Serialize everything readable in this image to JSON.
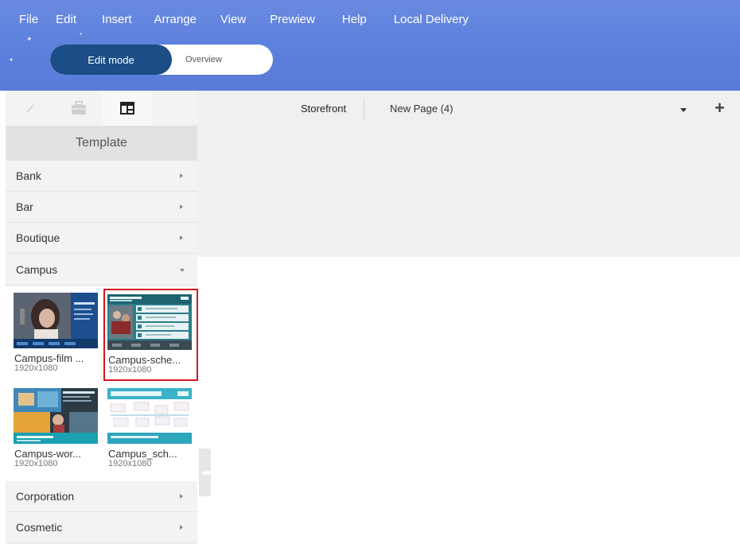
{
  "menu": {
    "items": [
      "File",
      "Edit",
      "Insert",
      "Arrange",
      "View",
      "Prewiew",
      "Help",
      "Local Delivery"
    ]
  },
  "mode_toggle": {
    "active_label": "Edit mode",
    "inactive_label": "Overview"
  },
  "sidebar": {
    "tools": [
      "pencil-icon",
      "briefcase-icon",
      "template-layout-icon"
    ],
    "heading": "Template",
    "categories": [
      {
        "label": "Bank",
        "expanded": false
      },
      {
        "label": "Bar",
        "expanded": false
      },
      {
        "label": "Boutique",
        "expanded": false
      },
      {
        "label": "Campus",
        "expanded": true
      },
      {
        "label": "Corporation",
        "expanded": false
      },
      {
        "label": "Cosmetic",
        "expanded": false
      }
    ],
    "templates": [
      {
        "name": "Campus-film ...",
        "resolution": "1920x1080",
        "selected": false
      },
      {
        "name": "Campus-sche...",
        "resolution": "1920x1080",
        "selected": true
      },
      {
        "name": "Campus-wor...",
        "resolution": "1920x1080",
        "selected": false
      },
      {
        "name": "Campus_sch...",
        "resolution": "1920x1080",
        "selected": false
      }
    ]
  },
  "page_tabs": {
    "tabs": [
      "Storefront",
      "New Page (4)"
    ]
  },
  "colors": {
    "header": "#5b7fdc",
    "active_mode": "#1b4d86",
    "selection_outline": "#d9141c"
  }
}
